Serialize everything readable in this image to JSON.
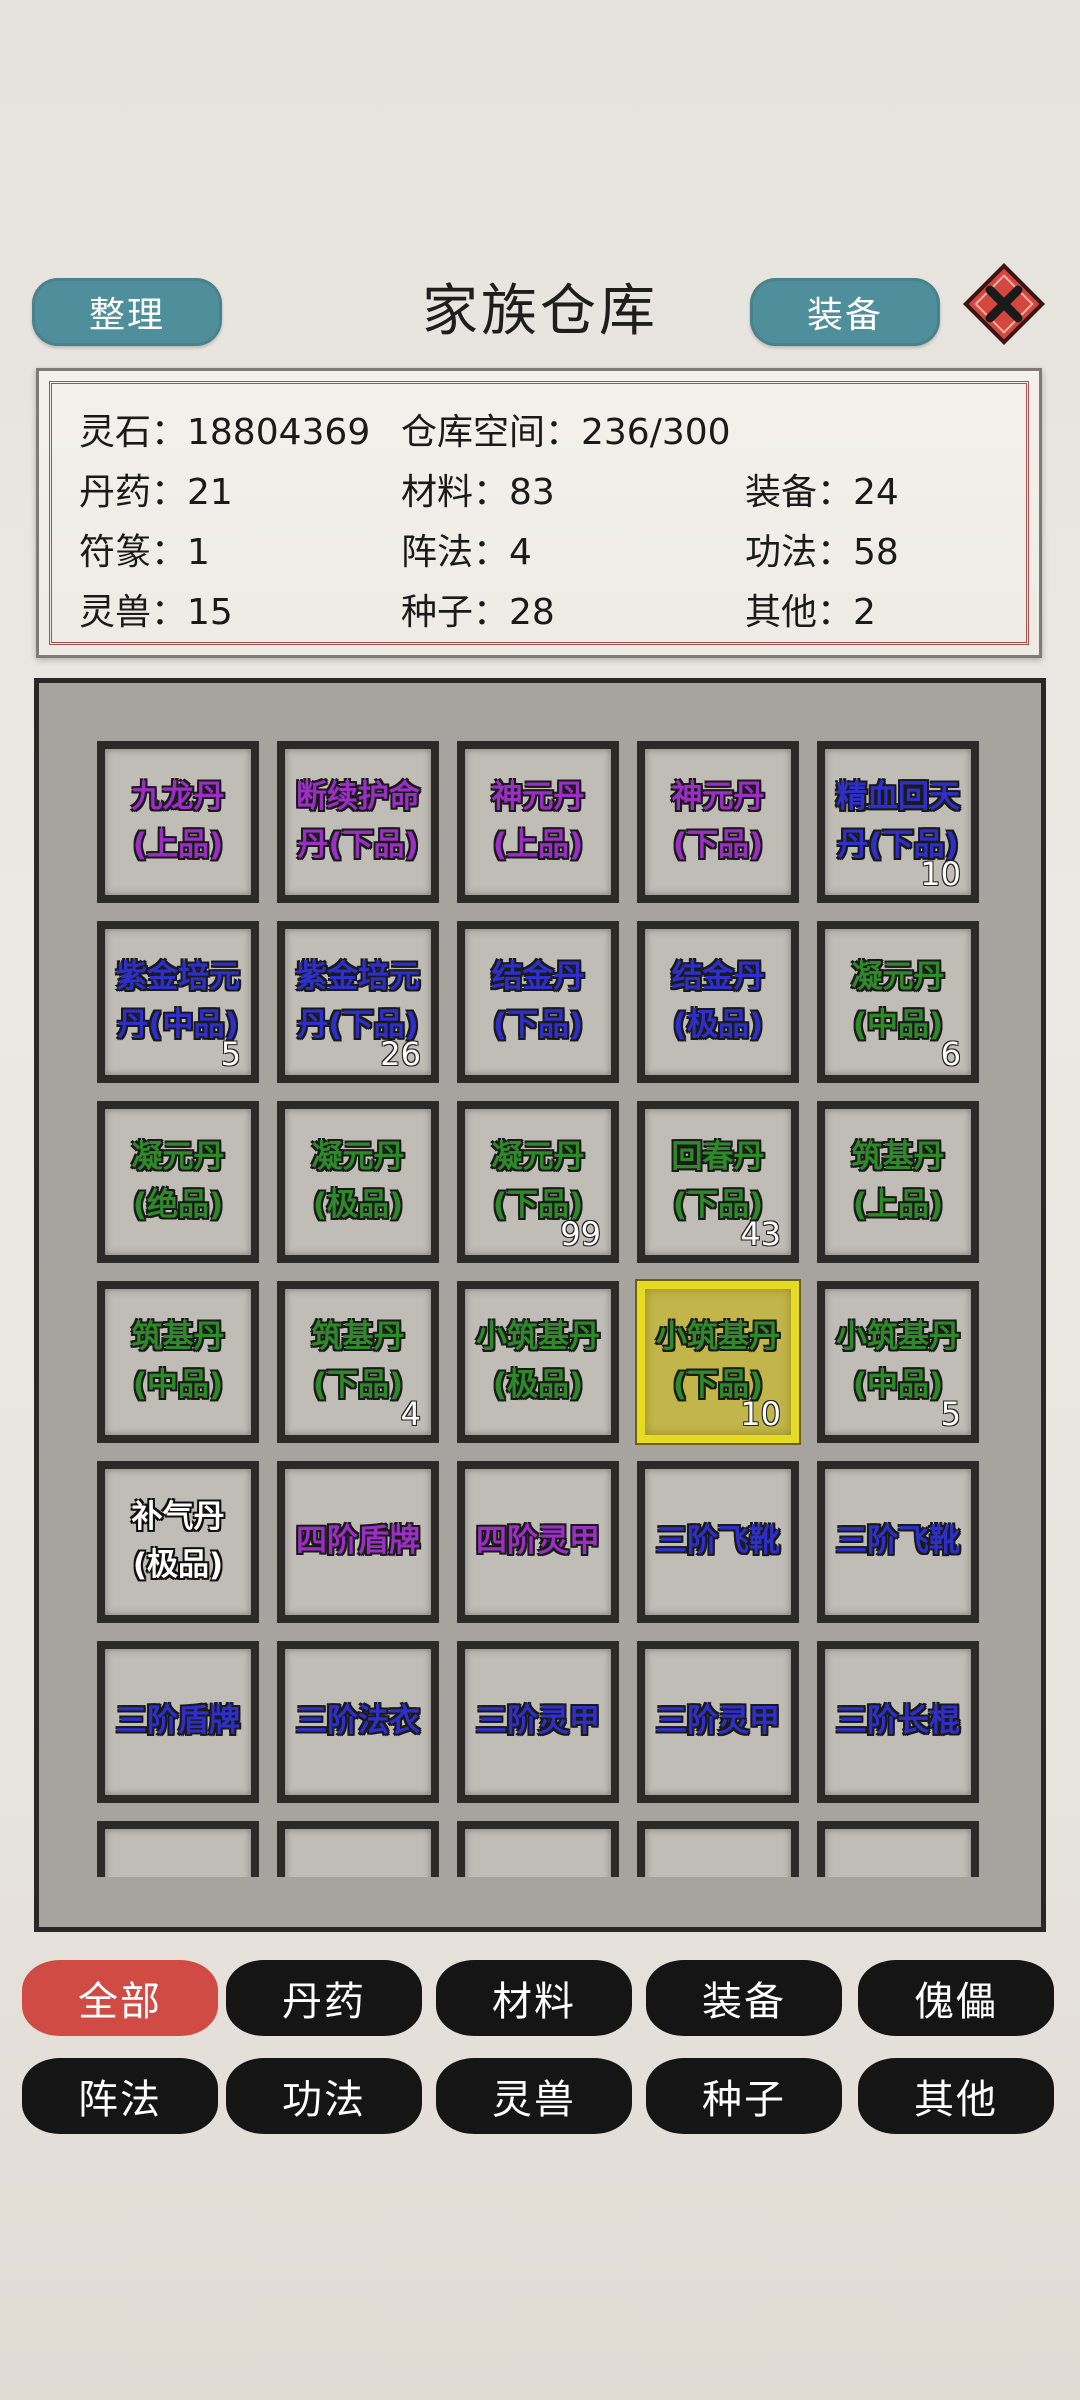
{
  "header": {
    "title": "家族仓库",
    "sort_label": "整理",
    "equip_label": "装备",
    "close_icon": "close-x-icon"
  },
  "info": {
    "spirit_stone": "灵石：18804369",
    "storage": "仓库空间：236/300",
    "pill": "丹药：21",
    "material": "材料：83",
    "equipment": "装备：24",
    "talisman": "符篆：1",
    "formation": "阵法：4",
    "technique": "功法：58",
    "beast": "灵兽：15",
    "seed": "种子：28",
    "other": "其他：2"
  },
  "colors": {
    "purple": "#9b2fc4",
    "blue": "#2d2fc8",
    "green": "#2e8a28",
    "white": "#ffffff",
    "active_tab": "#cf4b44",
    "button": "#4f8f9c"
  },
  "items": [
    {
      "name": "九龙丹\n(上品)",
      "count": "",
      "color": "#9b2fc4"
    },
    {
      "name": "断续护命\n丹(下品)",
      "count": "",
      "color": "#9b2fc4"
    },
    {
      "name": "神元丹\n(上品)",
      "count": "",
      "color": "#9b2fc4"
    },
    {
      "name": "神元丹\n(下品)",
      "count": "",
      "color": "#9b2fc4"
    },
    {
      "name": "精血回天\n丹(下品)",
      "count": "10",
      "color": "#2d2fc8"
    },
    {
      "name": "紫金培元\n丹(中品)",
      "count": "5",
      "color": "#2d2fc8"
    },
    {
      "name": "紫金培元\n丹(下品)",
      "count": "26",
      "color": "#2d2fc8"
    },
    {
      "name": "结金丹\n(下品)",
      "count": "",
      "color": "#2d2fc8"
    },
    {
      "name": "结金丹\n(极品)",
      "count": "",
      "color": "#2d2fc8"
    },
    {
      "name": "凝元丹\n(中品)",
      "count": "6",
      "color": "#2e8a28"
    },
    {
      "name": "凝元丹\n(绝品)",
      "count": "",
      "color": "#2e8a28"
    },
    {
      "name": "凝元丹\n(极品)",
      "count": "",
      "color": "#2e8a28"
    },
    {
      "name": "凝元丹\n(下品)",
      "count": "99",
      "color": "#2e8a28"
    },
    {
      "name": "回春丹\n(下品)",
      "count": "43",
      "color": "#2e8a28"
    },
    {
      "name": "筑基丹\n(上品)",
      "count": "",
      "color": "#2e8a28"
    },
    {
      "name": "筑基丹\n(中品)",
      "count": "",
      "color": "#2e8a28"
    },
    {
      "name": "筑基丹\n(下品)",
      "count": "4",
      "color": "#2e8a28"
    },
    {
      "name": "小筑基丹\n(极品)",
      "count": "",
      "color": "#2e8a28"
    },
    {
      "name": "小筑基丹\n(下品)",
      "count": "10",
      "color": "#2e8a28",
      "selected": true
    },
    {
      "name": "小筑基丹\n(中品)",
      "count": "5",
      "color": "#2e8a28"
    },
    {
      "name": "补气丹\n(极品)",
      "count": "",
      "color": "#ffffff"
    },
    {
      "name": "四阶盾牌",
      "count": "",
      "color": "#9b2fc4"
    },
    {
      "name": "四阶灵甲",
      "count": "",
      "color": "#9b2fc4"
    },
    {
      "name": "三阶飞靴",
      "count": "",
      "color": "#2d2fc8"
    },
    {
      "name": "三阶飞靴",
      "count": "",
      "color": "#2d2fc8"
    },
    {
      "name": "三阶盾牌",
      "count": "",
      "color": "#2d2fc8"
    },
    {
      "name": "三阶法衣",
      "count": "",
      "color": "#2d2fc8"
    },
    {
      "name": "三阶灵甲",
      "count": "",
      "color": "#2d2fc8"
    },
    {
      "name": "三阶灵甲",
      "count": "",
      "color": "#2d2fc8"
    },
    {
      "name": "三阶长棍",
      "count": "",
      "color": "#2d2fc8"
    },
    {
      "name": "",
      "count": "",
      "color": "#2d2fc8"
    },
    {
      "name": "",
      "count": "",
      "color": "#2d2fc8"
    },
    {
      "name": "",
      "count": "",
      "color": "#2d2fc8"
    },
    {
      "name": "",
      "count": "",
      "color": "#2d2fc8"
    },
    {
      "name": "",
      "count": "",
      "color": "#2d2fc8"
    }
  ],
  "tabs": [
    {
      "label": "全部",
      "active": true
    },
    {
      "label": "丹药"
    },
    {
      "label": "材料"
    },
    {
      "label": "装备"
    },
    {
      "label": "傀儡"
    },
    {
      "label": "阵法"
    },
    {
      "label": "功法"
    },
    {
      "label": "灵兽"
    },
    {
      "label": "种子"
    },
    {
      "label": "其他"
    }
  ]
}
